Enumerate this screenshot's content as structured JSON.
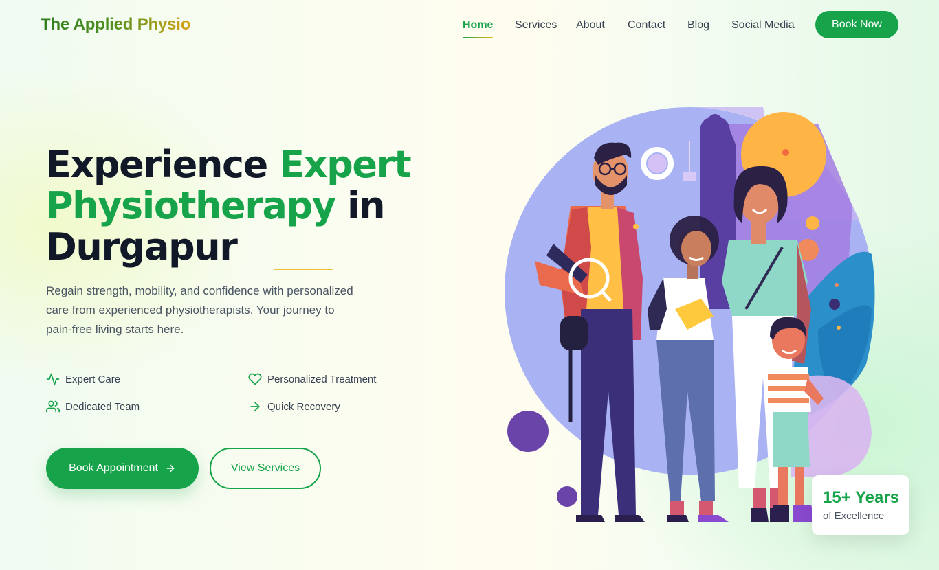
{
  "header": {
    "logo": "The Applied Physio",
    "nav": [
      {
        "label": "Home",
        "active": true
      },
      {
        "label": "Services",
        "active": false
      },
      {
        "label": "About",
        "active": false
      },
      {
        "label": "Contact",
        "active": false
      },
      {
        "label": "Blog",
        "active": false
      },
      {
        "label": "Social Media",
        "active": false
      }
    ],
    "cta_label": "Book Now"
  },
  "hero": {
    "title_part1": "Experience ",
    "title_accent": "Expert Physiotherapy",
    "title_part2": " in Durgapur",
    "description": "Regain strength, mobility, and confidence with personalized care from experienced physiotherapists. Your journey to pain-free living starts here.",
    "features": [
      {
        "label": "Expert Care",
        "icon": "pulse-icon"
      },
      {
        "label": "Personalized Treatment",
        "icon": "heart-icon"
      },
      {
        "label": "Dedicated Team",
        "icon": "users-icon"
      },
      {
        "label": "Quick Recovery",
        "icon": "arrow-right-icon"
      }
    ],
    "primary_button": "Book Appointment",
    "secondary_button": "View Services"
  },
  "stat": {
    "value": "15+ Years",
    "label": "of Excellence"
  },
  "colors": {
    "brand_green": "#16a34a",
    "accent_yellow": "#eab308",
    "text_dark": "#111827"
  }
}
